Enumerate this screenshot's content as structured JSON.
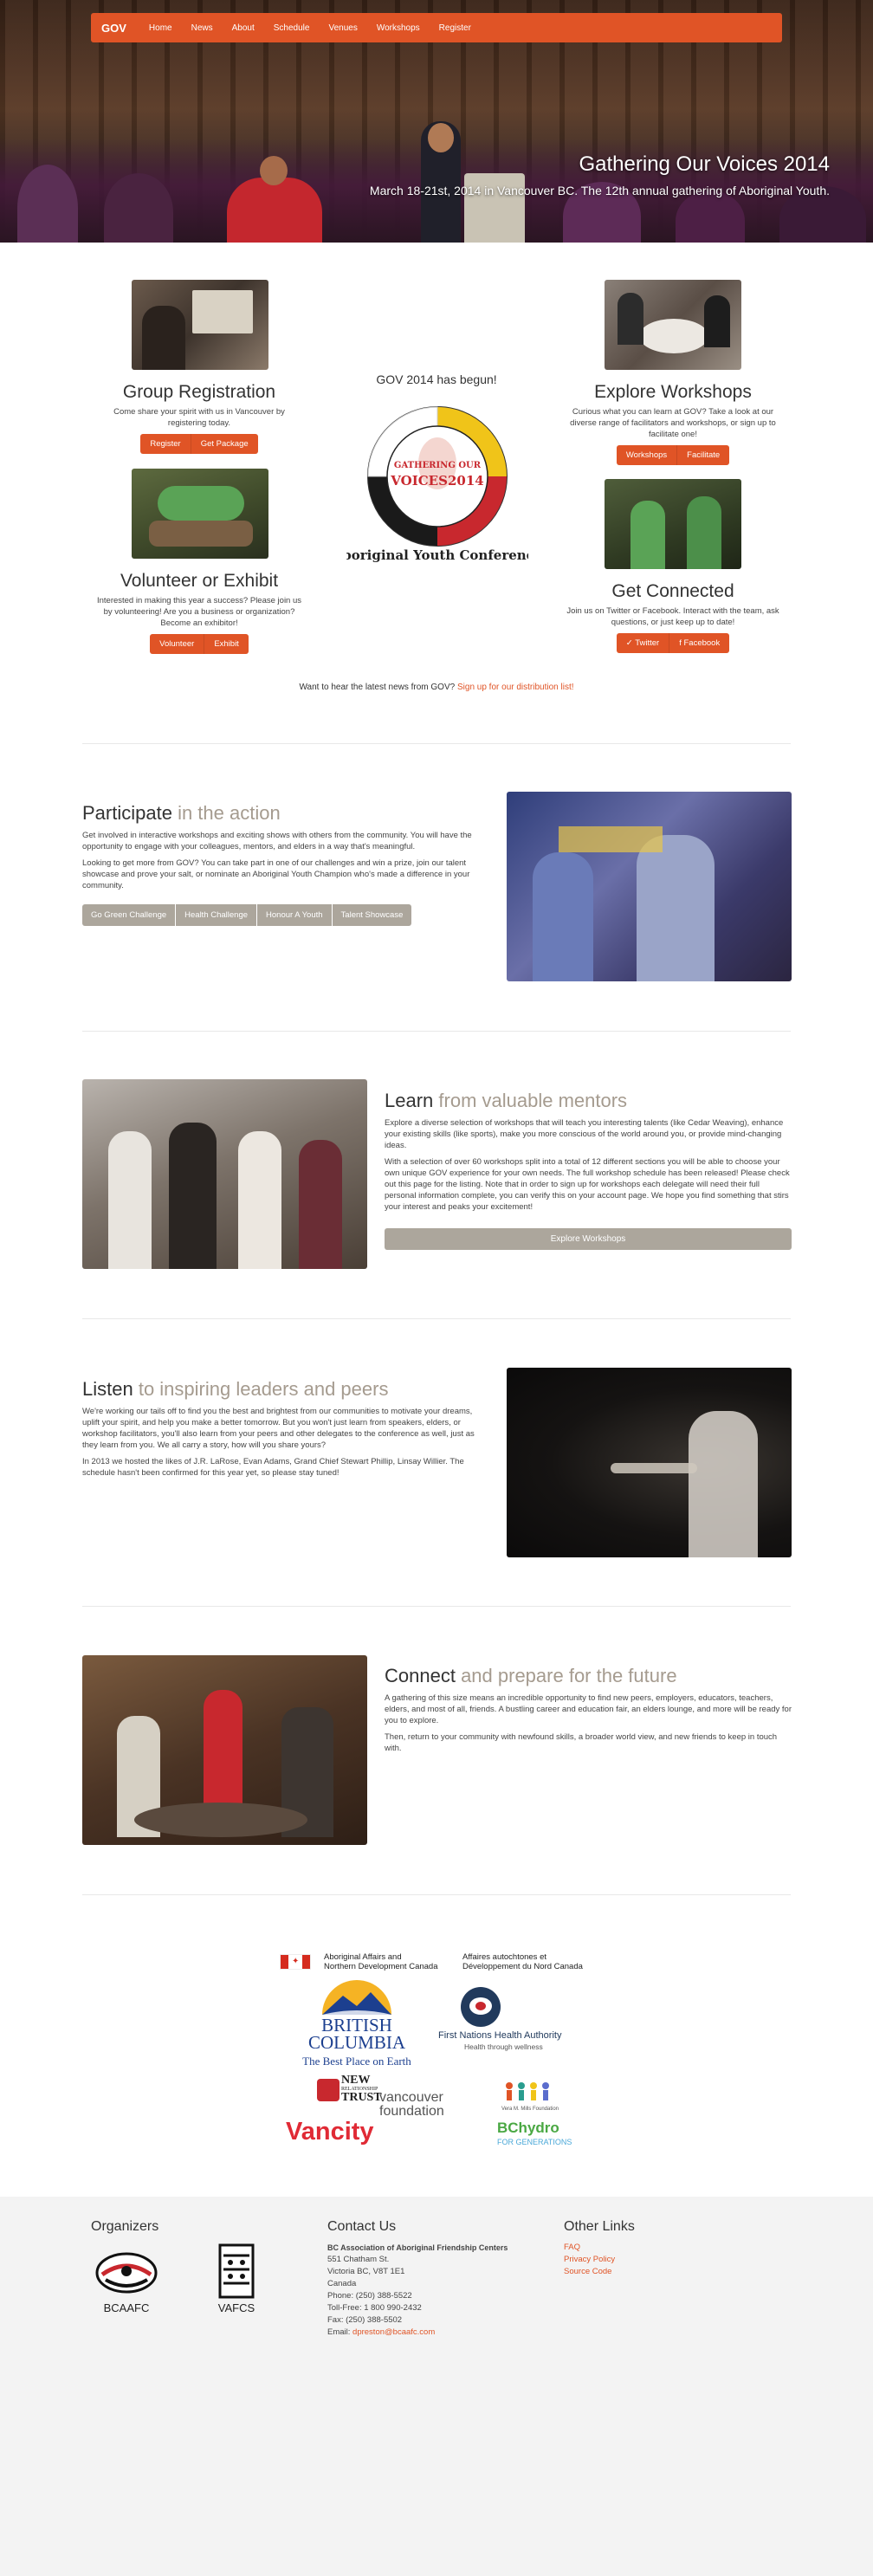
{
  "nav": {
    "brand": "GOV",
    "items": [
      "Home",
      "News",
      "About",
      "Schedule",
      "Venues",
      "Workshops",
      "Register"
    ]
  },
  "hero": {
    "title": "Gathering Our Voices 2014",
    "subtitle": "March 18-21st, 2014 in Vancouver BC. The 12th annual gathering of Aboriginal Youth."
  },
  "features": {
    "group": {
      "title": "Group Registration",
      "text": "Come share your spirit with us in Vancouver by registering today.",
      "buttons": [
        "Register",
        "Get Package"
      ]
    },
    "volunteer": {
      "title": "Volunteer or Exhibit",
      "text": "Interested in making this year a success? Please join us by volunteering! Are you a business or organization? Become an exhibitor!",
      "buttons": [
        "Volunteer",
        "Exhibit"
      ]
    },
    "explore": {
      "title": "Explore Workshops",
      "text": "Curious what you can learn at GOV? Take a look at our diverse range of facilitators and workshops, or sign up to facilitate one!",
      "buttons": [
        "Workshops",
        "Facilitate"
      ]
    },
    "connected": {
      "title": "Get Connected",
      "text": "Join us on Twitter or Facebook. Interact with the team, ask questions, or just keep up to date!",
      "buttons": [
        "Twitter",
        "Facebook"
      ]
    },
    "center_heading": "GOV 2014 has begun!",
    "logo_top": "GATHERING OUR",
    "logo_main": "VOICES2014",
    "logo_ring": "Aboriginal Youth Conference"
  },
  "news": {
    "text": "Want to hear the latest news from GOV? ",
    "link": "Sign up for our distribution list!"
  },
  "participate": {
    "title": "Participate",
    "title_muted": " in the action",
    "p1": "Get involved in interactive workshops and exciting shows with others from the community. You will have the opportunity to engage with your colleagues, mentors, and elders in a way that's meaningful.",
    "p2": "Looking to get more from GOV? You can take part in one of our challenges and win a prize, join our talent showcase and prove your salt, or nominate an Aboriginal Youth Champion who's made a difference in your community.",
    "buttons": [
      "Go Green Challenge",
      "Health Challenge",
      "Honour A Youth",
      "Talent Showcase"
    ]
  },
  "learn": {
    "title": "Learn",
    "title_muted": " from valuable mentors",
    "p1": "Explore a diverse selection of workshops that will teach you interesting talents (like Cedar Weaving), enhance your existing skills (like sports), make you more conscious of the world around you, or provide mind-changing ideas.",
    "p2": "With a selection of over 60 workshops split into a total of 12 different sections you will be able to choose your own unique GOV experience for your own needs. The full workshop schedule has been released! Please check out this page for the listing. Note that in order to sign up for workshops each delegate will need their full personal information complete, you can verify this on your account page. We hope you find something that stirs your interest and peaks your excitement!",
    "button": "Explore Workshops"
  },
  "listen": {
    "title": "Listen",
    "title_muted": " to inspiring leaders and peers",
    "p1": "We're working our tails off to find you the best and brightest from our communities to motivate your dreams, uplift your spirit, and help you make a better tomorrow. But you won't just learn from speakers, elders, or workshop facilitators, you'll also learn from your peers and other delegates to the conference as well, just as they learn from you. We all carry a story, how will you share yours?",
    "p2": "In 2013 we hosted the likes of J.R. LaRose, Evan Adams, Grand Chief Stewart Phillip, Linsay Willier. The schedule hasn't been confirmed for this year yet, so please stay tuned!"
  },
  "connect": {
    "title": "Connect",
    "title_muted": " and prepare for the future",
    "p1": "A gathering of this size means an incredible opportunity to find new peers, employers, educators, teachers, elders, and most of all, friends. A bustling career and education fair, an elders lounge, and more will be ready for you to explore.",
    "p2": "Then, return to your community with newfound skills, a broader world view, and new friends to keep in touch with."
  },
  "sponsors": {
    "aandc_en_1": "Aboriginal Affairs and",
    "aandc_en_2": "Northern Development Canada",
    "aandc_fr_1": "Affaires autochtones et",
    "aandc_fr_2": "Développement du Nord Canada",
    "bc_1": "BRITISH",
    "bc_2": "COLUMBIA",
    "bc_3": "The Best Place on Earth",
    "fnha_1": "First Nations Health Authority",
    "fnha_2": "Health through wellness",
    "nrt_1": "NEW",
    "nrt_2": "RELATIONSHIP",
    "nrt_3": "TRUST",
    "vanfound": "vancouver foundation",
    "vancity": "Vancity",
    "bchydro_1": "BChydro",
    "bchydro_2": "FOR GENERATIONS",
    "mills": "Vera M. Mills Foundation"
  },
  "footer": {
    "organizers_title": "Organizers",
    "org1": "BCAAFC",
    "org2": "VAFCS",
    "contact_title": "Contact Us",
    "contact_org": "BC Association of Aboriginal Friendship Centers",
    "addr1": "551 Chatham St.",
    "addr2": "Victoria BC, V8T 1E1",
    "addr3": "Canada",
    "phone": "Phone: (250) 388-5522",
    "tollfree": "Toll-Free: 1 800 990-2432",
    "fax": "Fax: (250) 388-5502",
    "email_label": "Email: ",
    "email": "dpreston@bcaafc.com",
    "other_title": "Other Links",
    "links": [
      "FAQ",
      "Privacy Policy",
      "Source Code"
    ]
  },
  "colors": {
    "accent": "#e05426",
    "muted_heading": "#a59b8f",
    "grey_button": "#aca69c",
    "footer_bg": "#f3f3f3"
  }
}
